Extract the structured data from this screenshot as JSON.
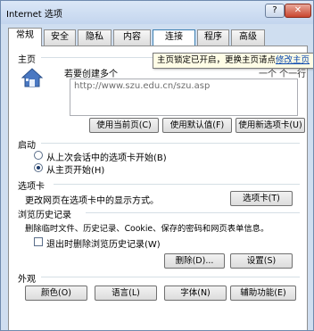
{
  "window": {
    "title": "Internet 选项",
    "help_label": "?",
    "close_label": "✕"
  },
  "tabs": [
    "常规",
    "安全",
    "隐私",
    "内容",
    "连接",
    "程序",
    "高级"
  ],
  "home": {
    "section_label": "主页",
    "description_prefix": "若要创建多个",
    "description_suffix": "一个 个一行",
    "url": "http://www.szu.edu.cn/szu.asp",
    "buttons": [
      "使用当前页(C)",
      "使用默认值(F)",
      "使用新选项卡(U)"
    ]
  },
  "tooltip": {
    "text": "主页锁定已开启，更换主页请点",
    "link": "修改主页"
  },
  "startup": {
    "section_label": "启动",
    "options": [
      {
        "label": "从上次会话中的选项卡开始(B)",
        "selected": false
      },
      {
        "label": "从主页开始(H)",
        "selected": true
      }
    ]
  },
  "tabs_section": {
    "section_label": "选项卡",
    "description": "更改网页在选项卡中的显示方式。",
    "button": "选项卡(T)"
  },
  "history": {
    "section_label": "浏览历史记录",
    "description": "删除临时文件、历史记录、Cookie、保存的密码和网页表单信息。",
    "checkbox_label": "退出时删除浏览历史记录(W)",
    "checkbox_checked": false,
    "delete_button": "删除(D)...",
    "settings_button": "设置(S)"
  },
  "appearance": {
    "section_label": "外观",
    "buttons": [
      "颜色(O)",
      "语言(L)",
      "字体(N)",
      "辅助功能(E)"
    ]
  }
}
